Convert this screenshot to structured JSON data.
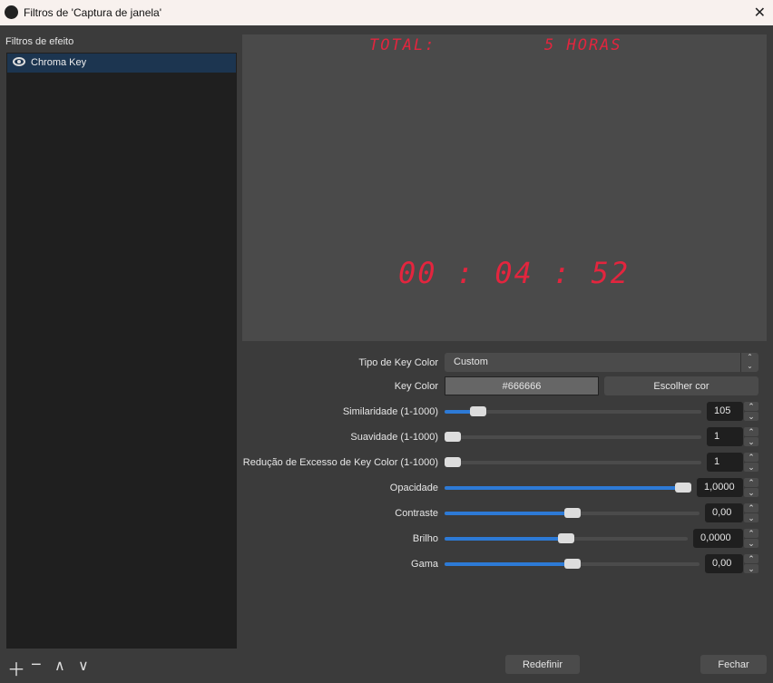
{
  "window": {
    "title": "Filtros de 'Captura de janela'"
  },
  "sidebar": {
    "heading": "Filtros de efeito",
    "items": [
      {
        "label": "Chroma Key",
        "icon": "eye-icon"
      }
    ]
  },
  "preview": {
    "top_left": "TOTAL:",
    "top_right": "5 HORAS",
    "timer": "00 : 04 : 52",
    "text_color": "#e3253e"
  },
  "props": {
    "key_type_label": "Tipo de Key Color",
    "key_type_value": "Custom",
    "key_color_label": "Key Color",
    "key_color_value": "#666666",
    "choose_color": "Escolher cor",
    "sliders": [
      {
        "label": "Similaridade (1-1000)",
        "value": "105",
        "fraction": 0.104
      },
      {
        "label": "Suavidade (1-1000)",
        "value": "1",
        "fraction": 0
      },
      {
        "label": "Redução de Excesso de Key Color (1-1000)",
        "value": "1",
        "fraction": 0
      },
      {
        "label": "Opacidade",
        "value": "1,0000",
        "fraction": 1
      },
      {
        "label": "Contraste",
        "value": "0,00",
        "fraction": 0.5
      },
      {
        "label": "Brilho",
        "value": "0,0000",
        "fraction": 0.5
      },
      {
        "label": "Gama",
        "value": "0,00",
        "fraction": 0.5
      }
    ]
  },
  "footer": {
    "reset": "Redefinir",
    "close": "Fechar"
  },
  "colors": {
    "accent": "#2d7ad6",
    "selection": "#1c3550"
  }
}
